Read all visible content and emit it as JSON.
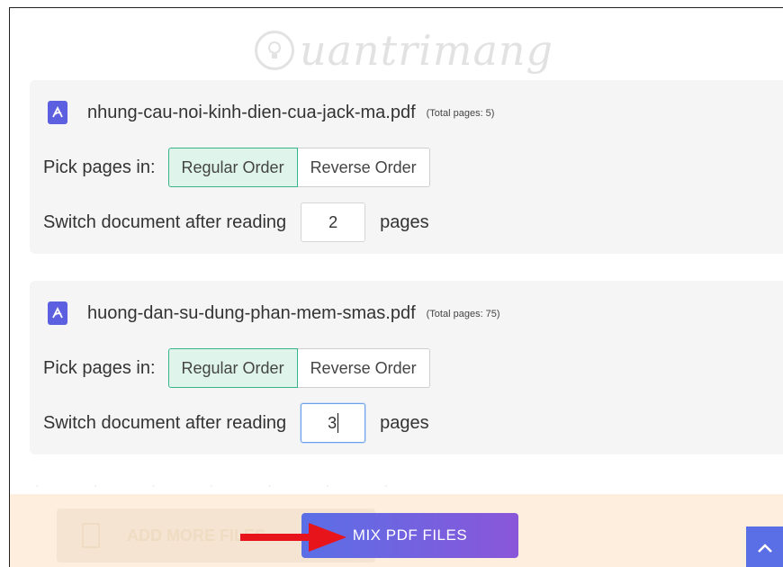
{
  "watermark": {
    "text": "uantrimang"
  },
  "files": [
    {
      "name": "nhung-cau-noi-kinh-dien-cua-jack-ma.pdf",
      "total_pages": "(Total pages: 5)",
      "pick_label": "Pick pages in:",
      "order_options": [
        "Regular Order",
        "Reverse Order"
      ],
      "selected_order": "Regular Order",
      "switch_label": "Switch document after reading",
      "switch_value": "2",
      "pages_label": "pages"
    },
    {
      "name": "huong-dan-su-dung-phan-mem-smas.pdf",
      "total_pages": "(Total pages: 75)",
      "pick_label": "Pick pages in:",
      "order_options": [
        "Regular Order",
        "Reverse Order"
      ],
      "selected_order": "Regular Order",
      "switch_label": "Switch document after reading",
      "switch_value": "3",
      "pages_label": "pages"
    }
  ],
  "actions": {
    "add_more_label": "ADD MORE FILES",
    "mix_label": "MIX PDF FILES"
  },
  "icons": {
    "pdf": "pdf-file-icon",
    "add": "add-files-icon",
    "scroll_top": "chevron-up-icon"
  },
  "colors": {
    "accent": "#5a6fe6",
    "active_order": "#3bb38a",
    "arrow": "#e8141b"
  }
}
